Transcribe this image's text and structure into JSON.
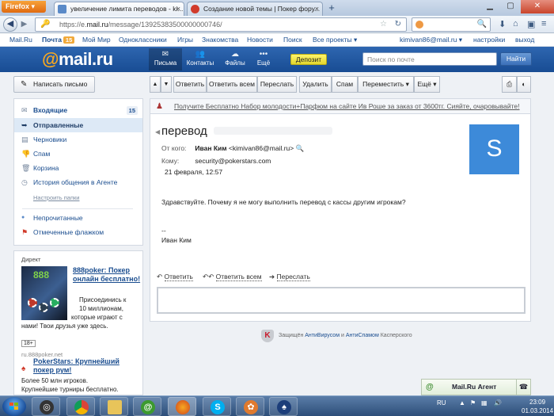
{
  "browser": {
    "menu_label": "Firefox",
    "tabs": [
      {
        "title": "увеличение лимита переводов - ki...",
        "active": true
      },
      {
        "title": "Создание новой темы | Покер фору...",
        "active": false
      }
    ],
    "new_tab_label": "+",
    "url_prefix": "https://e.",
    "url_host": "mail.ru",
    "url_path": "/message/13925383500000000746/",
    "window_min": "▁",
    "window_max": "▢",
    "window_close": "✕"
  },
  "portal": {
    "links": [
      "Mail.Ru",
      "Почта",
      "Мой Мир",
      "Одноклассники",
      "Игры",
      "Знакомства",
      "Новости",
      "Поиск",
      "Все проекты ▾"
    ],
    "mail_badge": "15",
    "user_email": "kimivan86@mail.ru ▾",
    "settings": "настройки",
    "logout": "выход"
  },
  "header": {
    "logo_at": "@",
    "logo_text": "mail.ru",
    "nav": [
      {
        "label": "Письма",
        "icon": "✉"
      },
      {
        "label": "Контакты",
        "icon": "👥"
      },
      {
        "label": "Файлы",
        "icon": "☁"
      },
      {
        "label": "Ещё",
        "icon": "•••"
      }
    ],
    "deposit_label": "Депозит",
    "search_placeholder": "Поиск по почте",
    "search_button": "Найти"
  },
  "sidebar": {
    "compose_label": "Написать письмо",
    "folders": [
      {
        "label": "Входящие",
        "count": "15",
        "icon": "✉"
      },
      {
        "label": "Отправленные",
        "icon": "➥"
      },
      {
        "label": "Черновики",
        "icon": "▤"
      },
      {
        "label": "Спам",
        "icon": "👎"
      },
      {
        "label": "Корзина",
        "icon": "🗑"
      },
      {
        "label": "История общения в Агенте",
        "icon": "◷"
      }
    ],
    "setup_link": "Настроить папки",
    "filters": [
      {
        "label": "Непрочитанные",
        "icon": "●"
      },
      {
        "label": "Отмеченные флажком",
        "icon": "⚑"
      }
    ]
  },
  "ads": {
    "label": "Директ",
    "ad1_title": "888poker: Покер онлайн бесплатно!",
    "ad1_text_a": "Присоединись к",
    "ad1_text_b": "10 миллионам,",
    "ad1_text_c": "которые играют с",
    "ad1_text_d": "нами! Твои друзья уже здесь.",
    "ad1_age": "18+",
    "ad1_url": "ru.888poker.net",
    "ad1_logo": "888",
    "ad2_title": "PokerStars: Крупнейший покер рум!",
    "ad2_text_a": "Более 50 млн игроков.",
    "ad2_text_b": "Крупнейшие турниры бесплатно."
  },
  "toolbar": {
    "reply": "Ответить",
    "reply_all": "Ответить всем",
    "forward": "Переслать",
    "delete": "Удалить",
    "spam": "Спам",
    "move": "Переместить ▾",
    "more": "Ещё ▾"
  },
  "promo": {
    "text": "Получите Бесплатно Набор молодости+Парфюм на сайте Ив Роше за заказ от 3600тг. Сияйте, очаровывайте!"
  },
  "message": {
    "subject": "перевод",
    "from_label": "От кого:",
    "from_name": "Иван Ким",
    "from_email": "<kimivan86@mail.ru>",
    "to_label": "Кому:",
    "to_email": "security@pokerstars.com",
    "date": "21 февраля, 12:57",
    "avatar_letter": "S",
    "body": "Здравствуйте.  Почему я не могу выполнить перевод с кассы другим игрокам?",
    "sig_dash": "--",
    "signature": "Иван Ким",
    "action_reply": "Ответить",
    "action_reply_all": "Ответить всем",
    "action_forward": "Переслать"
  },
  "kaspersky": {
    "prefix": "Защищён",
    "antivirus": "АнтиВирусом",
    "and": "и",
    "antispam": "АнтиСпамом",
    "suffix": "Касперского"
  },
  "agent": {
    "label": "Mail.Ru Агент"
  },
  "taskbar": {
    "lang": "RU",
    "time": "23:09",
    "date": "01.03.2014"
  }
}
